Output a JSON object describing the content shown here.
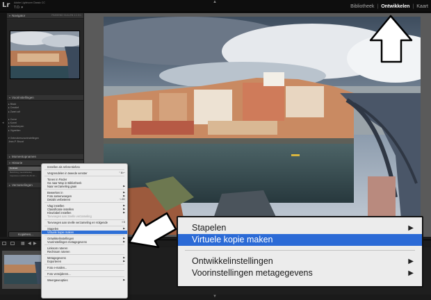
{
  "app": {
    "logo": "Lr",
    "title": "Adobe Lightroom Classic CC",
    "user": "T.O. ▾"
  },
  "modules": [
    {
      "label": "Bibliotheek",
      "active": false
    },
    {
      "label": "Ontwikkelen",
      "active": true
    },
    {
      "label": "Kaart",
      "active": false
    }
  ],
  "left_panel": {
    "navigator": {
      "title": "Navigator",
      "options": "PASSEND  VULLEN  1:1  3:1"
    },
    "presets": {
      "title": "Voorinstellingen",
      "items": [
        "▸ Black",
        "▸ Creatief",
        "▸ Zwart-wit",
        "",
        "▸ Curve",
        "▸ Korrel",
        "▸ Verscherpen",
        "▸ Vignetten",
        "",
        "▾ Gebruikersvoorinstellingen",
        "      Jean-P. Bruzzi"
      ]
    },
    "snapshots": {
      "title": "Momentopnamen"
    },
    "history": {
      "title": "Historie",
      "items": [
        "Contrast",
        "Belichting (neutralisatie)",
        "Importeren (2015-02-26 10:..."
      ],
      "selected_index": 0
    },
    "collections": {
      "title": "Verzamelingen"
    },
    "copy_button": "Kopiëren..."
  },
  "context_menu": {
    "items": [
      {
        "label": "Instellen als referentiefoto",
        "type": "item"
      },
      {
        "type": "sep"
      },
      {
        "label": "Vergrendelen in tweede venster",
        "type": "item",
        "shortcut": "⌃⌘↵"
      },
      {
        "type": "sep"
      },
      {
        "label": "Tonen in Finder",
        "type": "item"
      },
      {
        "label": "Ga naar Map in Bibliotheek",
        "type": "item"
      },
      {
        "label": "Naar verzameling gaan",
        "type": "submenu"
      },
      {
        "type": "sep"
      },
      {
        "label": "Bewerken in",
        "type": "submenu"
      },
      {
        "label": "Foto samenvoegen",
        "type": "submenu"
      },
      {
        "label": "Details verbeteren",
        "type": "item",
        "shortcut": "⌥⌘I"
      },
      {
        "type": "sep"
      },
      {
        "label": "Vlag instellen",
        "type": "submenu"
      },
      {
        "label": "Classificatie instellen",
        "type": "submenu"
      },
      {
        "label": "Kleurlabel instellen",
        "type": "submenu"
      },
      {
        "label": "Toevoegen aan Snelle verzameling",
        "type": "disabled"
      },
      {
        "type": "sep"
      },
      {
        "label": "Toevoegen aan snelle verzameling en Volgende",
        "type": "item",
        "shortcut": "⇧B"
      },
      {
        "type": "sep"
      },
      {
        "label": "Stapelen",
        "type": "submenu"
      },
      {
        "label": "Virtuele kopie maken",
        "type": "highlight"
      },
      {
        "type": "sep"
      },
      {
        "label": "Ontwikkelinstellingen",
        "type": "submenu"
      },
      {
        "label": "Voorinstellingen metagegevens",
        "type": "submenu"
      },
      {
        "type": "sep"
      },
      {
        "label": "Linksom roteren",
        "type": "item"
      },
      {
        "label": "Rechtsom roteren",
        "type": "item"
      },
      {
        "type": "sep"
      },
      {
        "label": "Metagegevens",
        "type": "submenu"
      },
      {
        "label": "Exporteren",
        "type": "submenu"
      },
      {
        "type": "sep"
      },
      {
        "label": "Foto e-mailen...",
        "type": "item"
      },
      {
        "type": "sep"
      },
      {
        "label": "Foto verwijderen...",
        "type": "item"
      },
      {
        "type": "sep"
      },
      {
        "label": "Weergaveopties",
        "type": "submenu"
      }
    ]
  },
  "zoom_menu": {
    "items": [
      {
        "label": "Stapelen",
        "type": "submenu"
      },
      {
        "label": "Virtuele kopie maken",
        "type": "highlight"
      },
      {
        "type": "sep"
      },
      {
        "label": "Ontwikkelinstellingen",
        "type": "submenu"
      },
      {
        "label": "Voorinstellingen metagegevens",
        "type": "submenu"
      }
    ]
  },
  "colors": {
    "highlight": "#2b6ad6",
    "menu_bg": "#ececec",
    "panel_bg": "#262626"
  },
  "icons": [
    "lightroom-logo",
    "up-arrow-annotation",
    "down-left-arrow-annotation",
    "submenu-arrow-icon"
  ]
}
